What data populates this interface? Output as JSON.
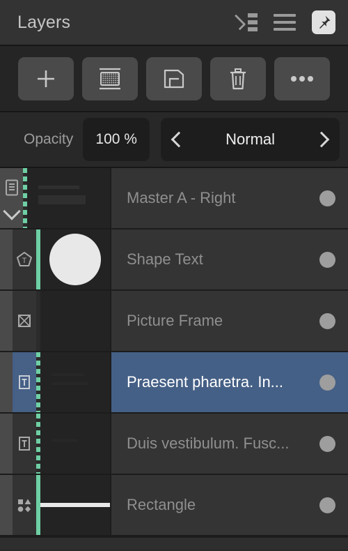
{
  "panel": {
    "title": "Layers",
    "header_icons": [
      {
        "name": "indent-list-icon"
      },
      {
        "name": "hamburger-menu-icon"
      },
      {
        "name": "pin-icon"
      }
    ]
  },
  "toolbar": {
    "buttons": [
      {
        "name": "add-layer-button",
        "icon": "plus-icon"
      },
      {
        "name": "mask-layer-button",
        "icon": "mask-icon"
      },
      {
        "name": "duplicate-layer-button",
        "icon": "duplicate-icon"
      },
      {
        "name": "delete-layer-button",
        "icon": "trash-icon"
      },
      {
        "name": "more-options-button",
        "icon": "ellipsis-icon"
      }
    ]
  },
  "opacity": {
    "label": "Opacity",
    "value": "100 %",
    "blend_mode": "Normal",
    "prev_icon": "chevron-left-icon",
    "next_icon": "chevron-right-icon"
  },
  "layers": [
    {
      "name": "Master A - Right",
      "type": "master",
      "icon": "master-page-icon",
      "expander": "chevron-down-icon",
      "selected": false,
      "marker": "dashed",
      "thumb": "text-lines",
      "visibility": "visible"
    },
    {
      "name": "Shape Text",
      "type": "shape-text",
      "icon": "pentagon-text-icon",
      "selected": false,
      "marker": "solid",
      "thumb": "circle",
      "visibility": "visible"
    },
    {
      "name": "Picture Frame",
      "type": "picture-frame",
      "icon": "picture-frame-icon",
      "selected": false,
      "marker": "none",
      "thumb": "empty",
      "visibility": "visible"
    },
    {
      "name": "Praesent pharetra. In...",
      "type": "text",
      "icon": "text-frame-icon",
      "selected": true,
      "marker": "dashed",
      "thumb": "faint-lines",
      "visibility": "visible"
    },
    {
      "name": "Duis vestibulum. Fusc...",
      "type": "text",
      "icon": "text-frame-icon",
      "selected": false,
      "marker": "dashed",
      "thumb": "faint-line",
      "visibility": "visible"
    },
    {
      "name": "Rectangle",
      "type": "shape",
      "icon": "shapes-icon",
      "selected": false,
      "marker": "solid",
      "thumb": "bar",
      "visibility": "visible"
    }
  ],
  "colors": {
    "panel_bg": "#2b2b2b",
    "header_bg": "#333333",
    "row_bg": "#343434",
    "selected_blue": "#456086",
    "marker_green": "#6ecfa4",
    "text_muted": "#8f8f8f",
    "text_bright": "#ffffff"
  }
}
